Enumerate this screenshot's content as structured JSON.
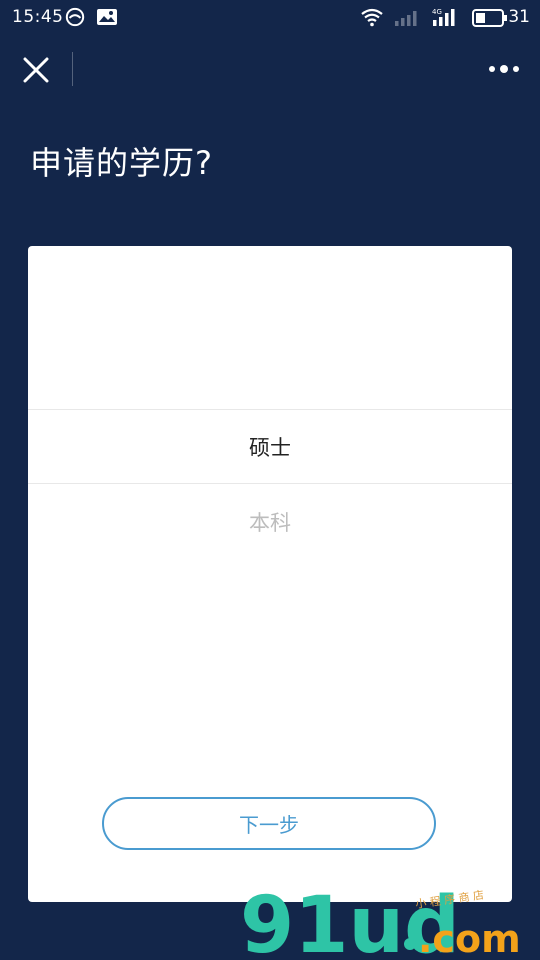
{
  "status_bar": {
    "time": "15:45",
    "battery_level": "31",
    "network_label": "4G"
  },
  "nav": {
    "close_icon": "close-icon",
    "more_icon": "more-dots-icon"
  },
  "question": {
    "title": "申请的学历?"
  },
  "picker": {
    "options": [
      {
        "label": "硕士",
        "state": "selected"
      },
      {
        "label": "本科",
        "state": "unselected"
      }
    ]
  },
  "actions": {
    "next_label": "下一步"
  },
  "watermark": {
    "brand": "91ud",
    "suffix": ".com",
    "tagline": "小 程 序 商 店"
  },
  "colors": {
    "background": "#13264a",
    "card": "#ffffff",
    "accent": "#4a9bd0",
    "watermark_green": "#2ec4a6",
    "watermark_orange": "#f3a21a"
  }
}
